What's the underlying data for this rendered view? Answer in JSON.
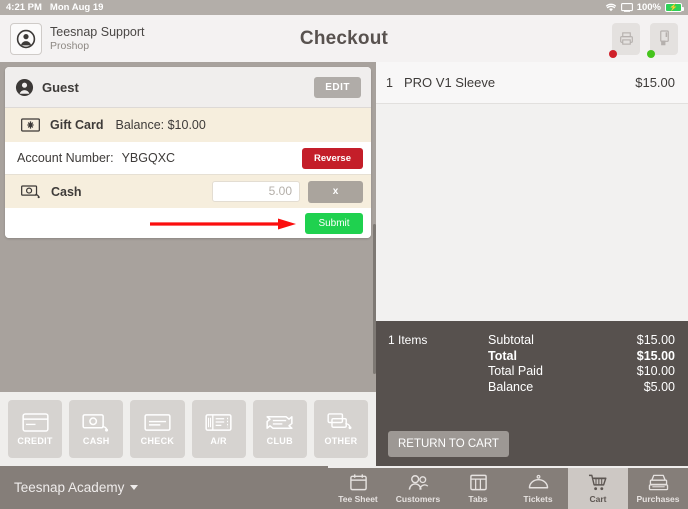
{
  "statusbar": {
    "time": "4:21 PM",
    "date": "Mon Aug 19",
    "battery_percent": "100%",
    "wifi_icon": "wifi-icon",
    "screen_icon": "screen-mirroring-icon"
  },
  "header": {
    "user_name": "Teesnap Support",
    "user_role": "Proshop",
    "title": "Checkout",
    "avatar_icon": "user-avatar-icon",
    "printer_icon": "printer-icon",
    "printer_status_color": "#d0212a",
    "card_reader_icon": "card-reader-icon",
    "card_reader_status_color": "#45c41d"
  },
  "payment_panel": {
    "guest": {
      "label": "Guest",
      "icon": "guest-avatar-icon",
      "edit_label": "EDIT"
    },
    "gift_card": {
      "icon": "gift-card-icon",
      "title": "Gift Card",
      "balance": "Balance: $10.00",
      "account_label": "Account Number:",
      "account_value": "YBGQXC",
      "reverse_label": "Reverse",
      "reverse_color": "#c41e29"
    },
    "cash": {
      "icon": "cash-icon",
      "title": "Cash",
      "amount_value": "5.00",
      "amount_placeholder": "0.00",
      "remove_label": "x",
      "submit_label": "Submit",
      "submit_color": "#1fd14f",
      "annotation_arrow_color": "#fb0e0e"
    }
  },
  "payment_types": [
    {
      "label": "CREDIT",
      "icon": "credit-card-icon"
    },
    {
      "label": "CASH",
      "icon": "cash-bill-icon"
    },
    {
      "label": "CHECK",
      "icon": "check-icon"
    },
    {
      "label": "A/R",
      "icon": "receipt-icon"
    },
    {
      "label": "CLUB",
      "icon": "club-ticket-icon"
    },
    {
      "label": "OTHER",
      "icon": "other-payments-icon"
    }
  ],
  "cart": {
    "items": [
      {
        "qty": "1",
        "name": "PRO V1 Sleeve",
        "price": "$15.00"
      }
    ],
    "items_count": "1 Items",
    "totals": [
      {
        "label": "Subtotal",
        "value": "$15.00",
        "bold": false
      },
      {
        "label": "Total",
        "value": "$15.00",
        "bold": true
      },
      {
        "label": "Total Paid",
        "value": "$10.00",
        "bold": false
      },
      {
        "label": "Balance",
        "value": "$5.00",
        "bold": false
      }
    ],
    "return_to_cart_label": "RETURN TO CART"
  },
  "bottombar": {
    "academy_label": "Teesnap Academy",
    "tabs": [
      {
        "label": "Tee Sheet",
        "icon": "tee-sheet-icon",
        "active": false
      },
      {
        "label": "Customers",
        "icon": "customers-icon",
        "active": false
      },
      {
        "label": "Tabs",
        "icon": "tabs-icon",
        "active": false
      },
      {
        "label": "Tickets",
        "icon": "tickets-icon",
        "active": false
      },
      {
        "label": "Cart",
        "icon": "cart-icon",
        "active": true
      },
      {
        "label": "Purchases",
        "icon": "purchases-register-icon",
        "active": false
      }
    ]
  }
}
